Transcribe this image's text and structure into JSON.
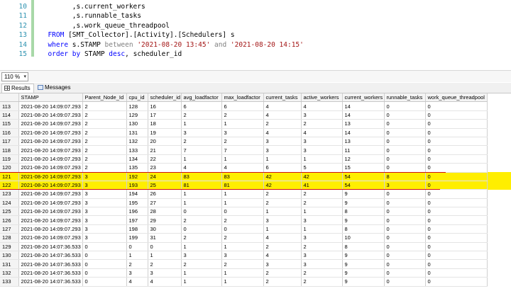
{
  "editor": {
    "lines": [
      {
        "num": "10",
        "segments": [
          {
            "t": "        ,s.current_workers",
            "c": ""
          }
        ]
      },
      {
        "num": "11",
        "segments": [
          {
            "t": "        ,s.runnable_tasks",
            "c": ""
          }
        ]
      },
      {
        "num": "12",
        "segments": [
          {
            "t": "        ,s.work_queue_threadpool",
            "c": ""
          }
        ]
      },
      {
        "num": "13",
        "segments": [
          {
            "t": "  ",
            "c": ""
          },
          {
            "t": "FROM",
            "c": "kw"
          },
          {
            "t": " [SMT_Collector].[Activity].[Schedulers] s",
            "c": ""
          }
        ]
      },
      {
        "num": "14",
        "segments": [
          {
            "t": "  ",
            "c": ""
          },
          {
            "t": "where",
            "c": "kw"
          },
          {
            "t": " s.STAMP ",
            "c": ""
          },
          {
            "t": "between",
            "c": "gray"
          },
          {
            "t": " ",
            "c": ""
          },
          {
            "t": "'2021-08-20 13:45'",
            "c": "str"
          },
          {
            "t": " ",
            "c": ""
          },
          {
            "t": "and",
            "c": "gray"
          },
          {
            "t": " ",
            "c": ""
          },
          {
            "t": "'2021-08-20 14:15'",
            "c": "str"
          }
        ]
      },
      {
        "num": "15",
        "segments": [
          {
            "t": "  ",
            "c": ""
          },
          {
            "t": "order by",
            "c": "kw"
          },
          {
            "t": " STAMP ",
            "c": ""
          },
          {
            "t": "desc",
            "c": "kw"
          },
          {
            "t": ", scheduler_id",
            "c": ""
          }
        ]
      }
    ]
  },
  "zoom": {
    "value": "110 %",
    "arrow": "▾"
  },
  "tabs": {
    "results": "Results",
    "messages": "Messages"
  },
  "grid": {
    "columns": [
      "STAMP",
      "Parent_Node_Id",
      "cpu_id",
      "scheduler_id",
      "avg_loadfactor",
      "max_loadfactor",
      "current_tasks",
      "active_workers",
      "current_workers",
      "runnable_tasks",
      "work_queue_threadpool"
    ],
    "highlighted_rows": [
      "121",
      "122"
    ],
    "rows": [
      [
        "113",
        "2021-08-20 14:09:07.293",
        "2",
        "128",
        "16",
        "6",
        "6",
        "4",
        "4",
        "14",
        "0",
        "0"
      ],
      [
        "114",
        "2021-08-20 14:09:07.293",
        "2",
        "129",
        "17",
        "2",
        "2",
        "4",
        "3",
        "14",
        "0",
        "0"
      ],
      [
        "115",
        "2021-08-20 14:09:07.293",
        "2",
        "130",
        "18",
        "1",
        "1",
        "2",
        "2",
        "13",
        "0",
        "0"
      ],
      [
        "116",
        "2021-08-20 14:09:07.293",
        "2",
        "131",
        "19",
        "3",
        "3",
        "4",
        "4",
        "14",
        "0",
        "0"
      ],
      [
        "117",
        "2021-08-20 14:09:07.293",
        "2",
        "132",
        "20",
        "2",
        "2",
        "3",
        "3",
        "13",
        "0",
        "0"
      ],
      [
        "118",
        "2021-08-20 14:09:07.293",
        "2",
        "133",
        "21",
        "7",
        "7",
        "3",
        "3",
        "11",
        "0",
        "0"
      ],
      [
        "119",
        "2021-08-20 14:09:07.293",
        "2",
        "134",
        "22",
        "1",
        "1",
        "1",
        "1",
        "12",
        "0",
        "0"
      ],
      [
        "120",
        "2021-08-20 14:09:07.293",
        "2",
        "135",
        "23",
        "4",
        "4",
        "6",
        "5",
        "15",
        "0",
        "0"
      ],
      [
        "121",
        "2021-08-20 14:09:07.293",
        "3",
        "192",
        "24",
        "83",
        "83",
        "42",
        "42",
        "54",
        "8",
        "0"
      ],
      [
        "122",
        "2021-08-20 14:09:07.293",
        "3",
        "193",
        "25",
        "81",
        "81",
        "42",
        "41",
        "54",
        "3",
        "0"
      ],
      [
        "123",
        "2021-08-20 14:09:07.293",
        "3",
        "194",
        "26",
        "1",
        "1",
        "2",
        "2",
        "9",
        "0",
        "0"
      ],
      [
        "124",
        "2021-08-20 14:09:07.293",
        "3",
        "195",
        "27",
        "1",
        "1",
        "2",
        "2",
        "9",
        "0",
        "0"
      ],
      [
        "125",
        "2021-08-20 14:09:07.293",
        "3",
        "196",
        "28",
        "0",
        "0",
        "1",
        "1",
        "8",
        "0",
        "0"
      ],
      [
        "126",
        "2021-08-20 14:09:07.293",
        "3",
        "197",
        "29",
        "2",
        "2",
        "3",
        "3",
        "9",
        "0",
        "0"
      ],
      [
        "127",
        "2021-08-20 14:09:07.293",
        "3",
        "198",
        "30",
        "0",
        "0",
        "1",
        "1",
        "8",
        "0",
        "0"
      ],
      [
        "128",
        "2021-08-20 14:09:07.293",
        "3",
        "199",
        "31",
        "2",
        "2",
        "4",
        "3",
        "10",
        "0",
        "0"
      ],
      [
        "129",
        "2021-08-20 14:07:36.533",
        "0",
        "0",
        "0",
        "1",
        "1",
        "2",
        "2",
        "8",
        "0",
        "0"
      ],
      [
        "130",
        "2021-08-20 14:07:36.533",
        "0",
        "1",
        "1",
        "3",
        "3",
        "4",
        "3",
        "9",
        "0",
        "0"
      ],
      [
        "131",
        "2021-08-20 14:07:36.533",
        "0",
        "2",
        "2",
        "2",
        "2",
        "3",
        "3",
        "9",
        "0",
        "0"
      ],
      [
        "132",
        "2021-08-20 14:07:36.533",
        "0",
        "3",
        "3",
        "1",
        "1",
        "2",
        "2",
        "9",
        "0",
        "0"
      ],
      [
        "133",
        "2021-08-20 14:07:36.533",
        "0",
        "4",
        "4",
        "1",
        "1",
        "2",
        "2",
        "9",
        "0",
        "0"
      ]
    ]
  },
  "colors": {
    "highlight": "#ffee00",
    "underline": "#d01010",
    "keyword": "#0000ff",
    "string": "#a31515",
    "line_number": "#2b91af"
  }
}
